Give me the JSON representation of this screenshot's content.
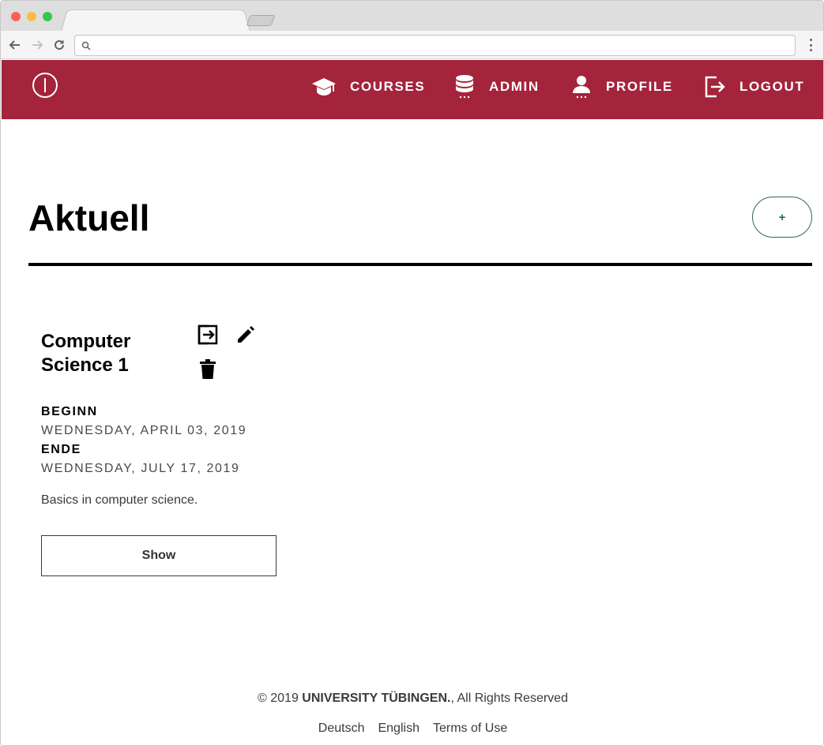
{
  "browser": {
    "url": ""
  },
  "header": {
    "nav": [
      {
        "label": "COURSES",
        "icon": "graduation-cap-icon"
      },
      {
        "label": "ADMIN",
        "icon": "database-icon"
      },
      {
        "label": "PROFILE",
        "icon": "user-icon"
      },
      {
        "label": "LOGOUT",
        "icon": "logout-icon"
      }
    ]
  },
  "main": {
    "title": "Aktuell",
    "add_label": "+",
    "course": {
      "title": "Computer Science 1",
      "begin_label": "BEGINN",
      "begin_date": "WEDNESDAY, APRIL 03, 2019",
      "end_label": "ENDE",
      "end_date": "WEDNESDAY, JULY 17, 2019",
      "description": "Basics in computer science.",
      "show_label": "Show"
    }
  },
  "footer": {
    "copyright_prefix": "© 2019 ",
    "copyright_org": "UNIVERSITY TÜBINGEN.",
    "copyright_suffix": ", All Rights Reserved",
    "links": [
      "Deutsch",
      "English",
      "Terms of Use"
    ]
  },
  "colors": {
    "brand": "#a3243b",
    "accent_green": "#2a6b52"
  }
}
